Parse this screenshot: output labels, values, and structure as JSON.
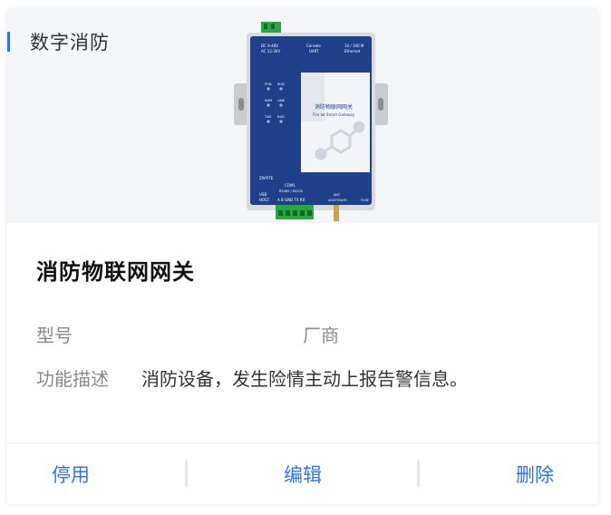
{
  "card": {
    "category": "数字消防",
    "title": "消防物联网网关",
    "fields": {
      "model_label": "型号",
      "model_value": "",
      "vendor_label": "厂商",
      "vendor_value": "",
      "description_label": "功能描述",
      "description_value": "消防设备，发生险情主动上报告警信息。"
    },
    "actions": {
      "disable": "停用",
      "edit": "编辑",
      "delete": "删除"
    }
  },
  "device": {
    "power_label": "DC 9-48V\nAC 12-36V",
    "console_label": "Console\nUART",
    "ethernet_label": "10 / 100 M\nEthernet",
    "led_labels": [
      "PON",
      "RUN",
      "NUM",
      "LINK",
      "TXD",
      "RXD"
    ],
    "product_name": "消防物联网网关",
    "product_subtitle": "Fire Iot Smart Gateway",
    "brand": "ZWYITE",
    "com_label": "COM1",
    "com_sub": "RS485 / RS232",
    "pins_label": "A  B  GND  TX  RX",
    "usb_label": "USB\nHOST",
    "ant_label": "ANT\n4G/LTE/WIFI",
    "fuse_label": "FUSE"
  },
  "colors": {
    "accent": "#2f74e6",
    "hero_bg": "#f4f5f7",
    "device_body": "#1e3f8a",
    "terminal_green": "#28a745"
  }
}
